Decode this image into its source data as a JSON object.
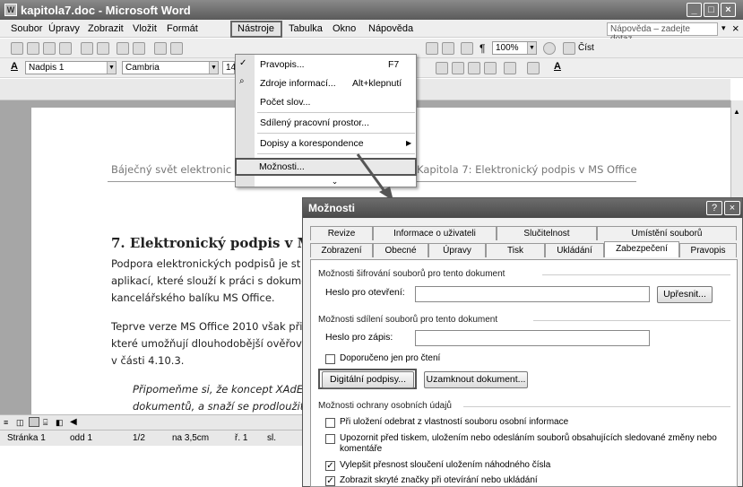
{
  "window": {
    "title": "kapitola7.doc - Microsoft Word"
  },
  "menubar": {
    "items": [
      "Soubor",
      "Úpravy",
      "Zobrazit",
      "Vložit",
      "Formát",
      "Nástroje",
      "Tabulka",
      "Okno",
      "Nápověda"
    ],
    "help_placeholder": "Nápověda – zadejte dotaz",
    "close": "×"
  },
  "toolbar": {
    "zoom": "100%",
    "read_label": "Číst",
    "style": "Nadpis 1",
    "font": "Cambria",
    "size": "14"
  },
  "tools_menu": {
    "items": [
      {
        "label": "Pravopis...",
        "shortcut": "F7"
      },
      {
        "label": "Zdroje informací...",
        "shortcut": "Alt+klepnutí"
      },
      {
        "label": "Počet slov...",
        "shortcut": ""
      },
      {
        "label": "Sdílený pracovní prostor...",
        "shortcut": ""
      },
      {
        "label": "Dopisy a korespondence",
        "shortcut": ""
      },
      {
        "label": "Možnosti...",
        "shortcut": ""
      }
    ],
    "more": "⌄"
  },
  "document": {
    "header_left": "Báječný svět elektronic",
    "header_right": "Kapitola 7: Elektronický podpis v MS Office",
    "heading": "7. Elektronický podpis v M",
    "p1": [
      "Podpora elektronických podpisů je st",
      "aplikací, které slouží k práci s dokume",
      "kancelářského balíku MS Office."
    ],
    "p2": [
      "Teprve verze MS Office 2010 však při",
      "které umožňují dlouhodobější ověřov",
      "v části 4.10.3."
    ],
    "quote": [
      "Připomeňme si, že koncept XAdE",
      "dokumentů, a snaží se prodloužit"
    ]
  },
  "statusbar": {
    "page": "Stránka 1",
    "section": "odd 1",
    "pages": "1/2",
    "at": "na 3,5cm",
    "line": "ř. 1",
    "col": "sl."
  },
  "dialog": {
    "title": "Možnosti",
    "help": "?",
    "close": "×",
    "tabs_row1": [
      "Revize",
      "Informace o uživateli",
      "Slučitelnost",
      "Umístění souborů"
    ],
    "tabs_row2": [
      "Zobrazení",
      "Obecné",
      "Úpravy",
      "Tisk",
      "Ukládání",
      "Zabezpečení",
      "Pravopis"
    ],
    "encrypt_group": "Možnosti šifrování souborů pro tento dokument",
    "open_password_label": "Heslo pro otevření:",
    "advanced_button": "Upřesnit...",
    "share_group": "Možnosti sdílení souborů pro tento dokument",
    "write_password_label": "Heslo pro zápis:",
    "readonly_label": "Doporučeno jen pro čtení",
    "digital_signatures_button": "Digitální podpisy...",
    "protect_button": "Uzamknout dokument...",
    "privacy_group": "Možnosti ochrany osobních údajů",
    "privacy_options": [
      {
        "label": "Při uložení odebrat z vlastností souboru osobní informace",
        "checked": false
      },
      {
        "label": "Upozornit před tiskem, uložením nebo odesláním souborů obsahujících sledované změny nebo",
        "label2": "komentáře",
        "checked": false
      },
      {
        "label": "Vylepšit přesnost sloučení uložením náhodného čísla",
        "checked": true
      },
      {
        "label": "Zobrazit skryté značky při otevírání nebo ukládání",
        "checked": true
      }
    ]
  }
}
